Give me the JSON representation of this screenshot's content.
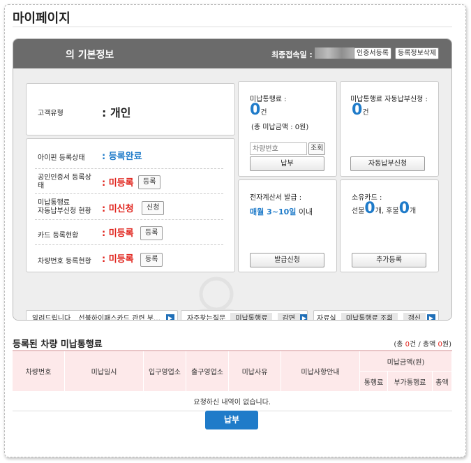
{
  "page": {
    "title": "마이페이지"
  },
  "info_card": {
    "title": "의 기본정보",
    "last_login_label": "최종접속일 :",
    "cert_reg_button": "인증서등록",
    "delete_info_button": "등록정보삭제"
  },
  "customer": {
    "type_label": "고객유형",
    "type_value": ": 개인"
  },
  "status_rows": [
    {
      "label": "아이핀 등록상태",
      "value": ": 등록완료",
      "button": ""
    },
    {
      "label": "공인인증서 등록상태",
      "value": ": 미등록",
      "button": "등록"
    },
    {
      "label_line1": "미납통행료",
      "label_line2": "자동납부신청 현황",
      "value": ": 미신청",
      "button": "신청"
    },
    {
      "label": "카드 등록현황",
      "value": ": 미등록",
      "button": "등록"
    },
    {
      "label": "차량번호 등록현황",
      "value": ": 미등록",
      "button": "등록"
    }
  ],
  "unpaid": {
    "title": "미납통행료 :",
    "count": "0",
    "unit": "건",
    "total": "(총 미납금액 : 0원)",
    "plate_placeholder": "차량번호",
    "search_button": "조회",
    "pay_button": "납부"
  },
  "auto_pay": {
    "title": "미납통행료 자동납부신청 :",
    "count": "0",
    "unit": "건",
    "button": "자동납부신청"
  },
  "e_invoice": {
    "title": "전자계산서 발급 :",
    "period": "매월 3~10일",
    "suffix": " 이내",
    "button": "발급신청"
  },
  "cards": {
    "title": "소유카드 :",
    "prepaid_label": "선불",
    "prepaid_count": "0",
    "postpaid_label": "후불",
    "postpaid_count": "0",
    "unit": "개",
    "separator": ",",
    "button": "추가등록"
  },
  "notice": {
    "label": "알려드립니다",
    "text": "선불하이패스카드 관련 부…"
  },
  "faq": {
    "label": "자주찾는질문",
    "tags": [
      "미납통행료",
      "감면"
    ]
  },
  "archive": {
    "label": "자료실",
    "tags": [
      "미납통행료 조회",
      "갱신"
    ]
  },
  "table": {
    "title": "등록된 차량 미납통행료",
    "summary_prefix": "(총 ",
    "count": "0",
    "summary_mid": "건 / 총액 ",
    "amount": "0",
    "summary_suffix": "원)",
    "headers": [
      "차량번호",
      "미납일시",
      "입구영업소",
      "출구영업소",
      "미납사유",
      "미납사항안내"
    ],
    "amount_header": "미납금액(원)",
    "amount_subheaders": [
      "통행료",
      "부가통행료",
      "총액"
    ],
    "empty_message": "요청하신 내역이 없습니다."
  },
  "pay_button": "납부",
  "colors": {
    "accent_blue": "#1f7bc9",
    "alert_red": "#e0221b",
    "header_gray": "#6b6b6b",
    "table_header_pink": "#fde9ea"
  }
}
